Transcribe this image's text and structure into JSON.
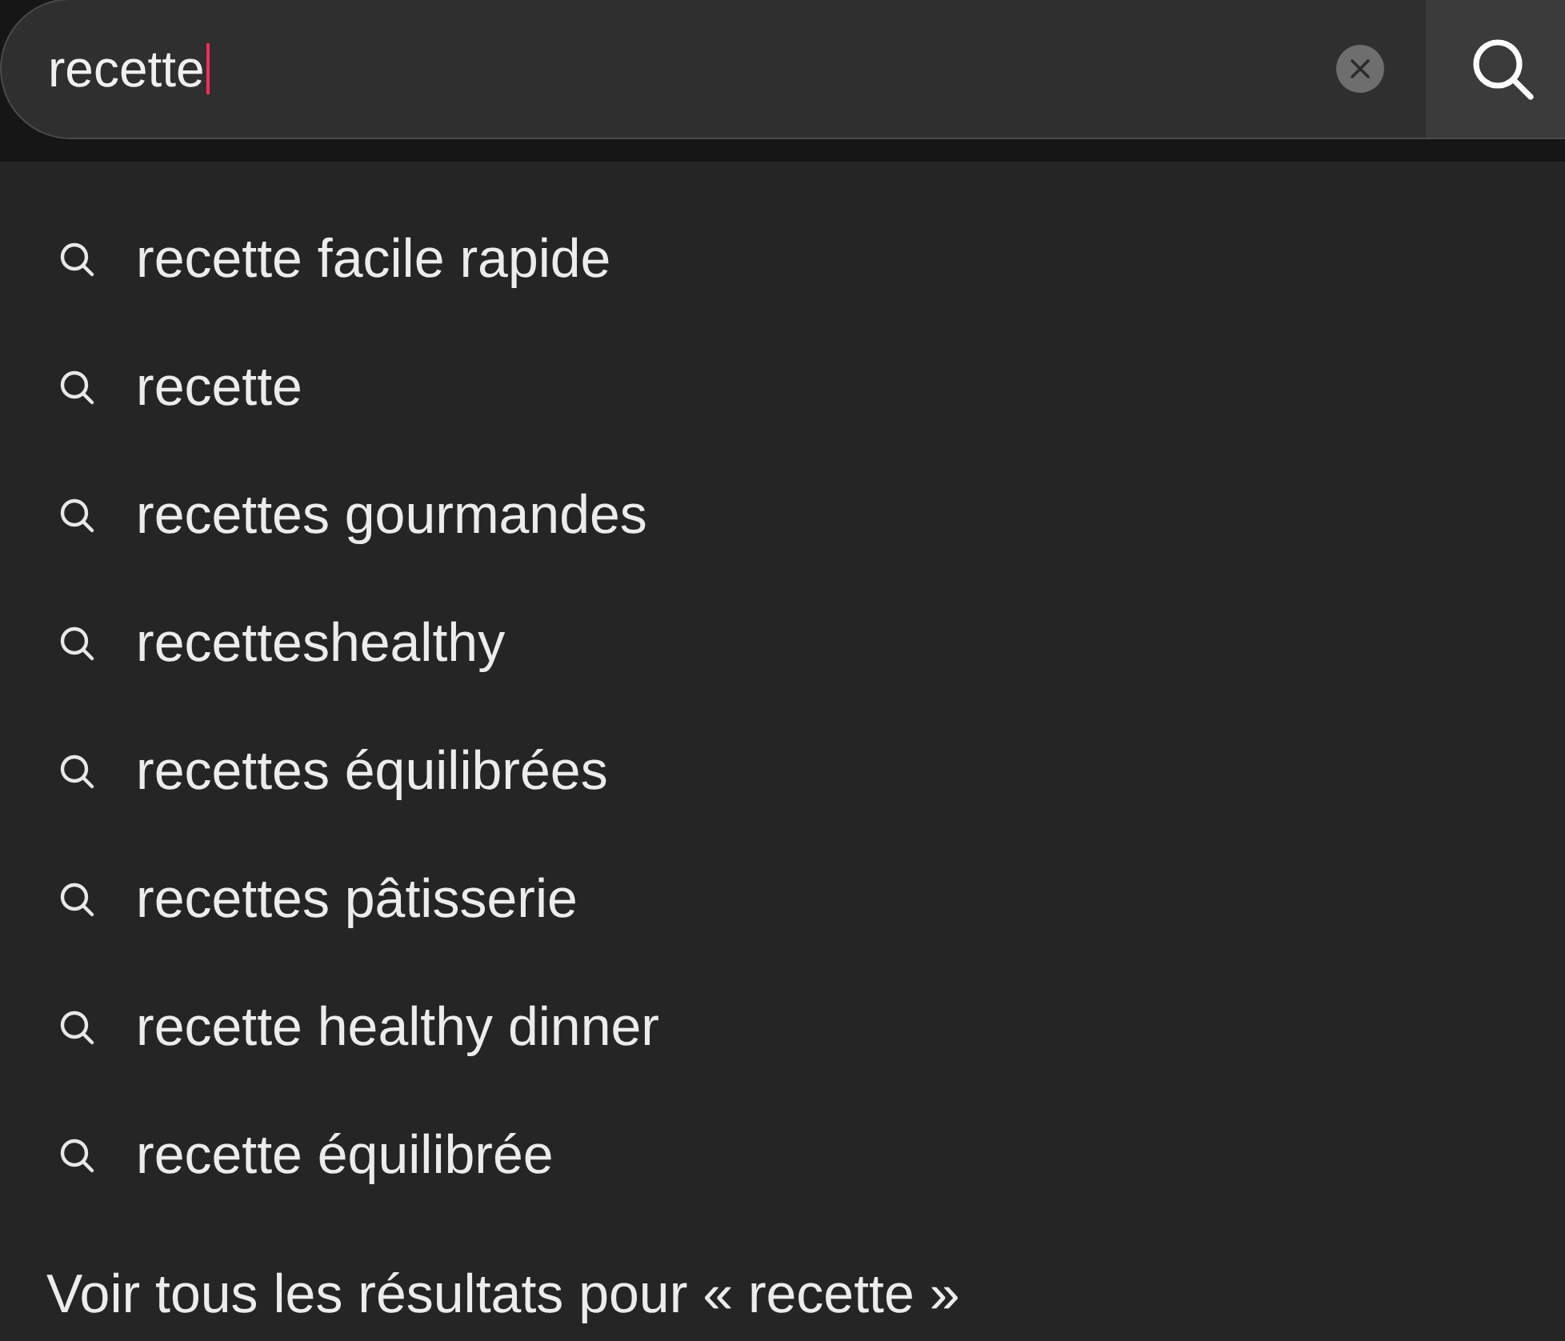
{
  "search": {
    "value": "recette",
    "focused": true
  },
  "suggestions": [
    {
      "label": "recette facile rapide"
    },
    {
      "label": "recette"
    },
    {
      "label": "recettes gourmandes"
    },
    {
      "label": "recetteshealthy"
    },
    {
      "label": "recettes équilibrées"
    },
    {
      "label": "recettes pâtisserie"
    },
    {
      "label": "recette healthy dinner"
    },
    {
      "label": "recette équilibrée"
    }
  ],
  "see_all": "Voir tous les résultats pour « recette »"
}
